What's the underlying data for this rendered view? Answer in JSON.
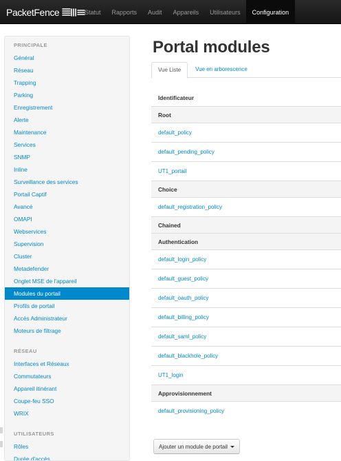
{
  "brand": {
    "name": "PacketFence",
    "logo_icon": "packetfence-logo-icon"
  },
  "navbar": {
    "items": [
      {
        "label": "Statut"
      },
      {
        "label": "Rapports"
      },
      {
        "label": "Audit"
      },
      {
        "label": "Appareils"
      },
      {
        "label": "Utilisateurs"
      },
      {
        "label": "Configuration",
        "active": true
      }
    ]
  },
  "sidebar": {
    "sections": [
      {
        "header": "PRINCIPALE",
        "items": [
          "Général",
          "Réseau",
          "Trapping",
          "Parking",
          "Enregistrement",
          "Alerte",
          "Maintenance",
          "Services",
          "SNMP",
          "Inline",
          "Surveillance des services",
          "Portail Captif",
          "Avancé",
          "OMAPI",
          "Webservices",
          "Supervision",
          "Cluster",
          "Metadefender",
          "Onglet MSE de l'appareil",
          "Modules du portail",
          "Profils de portail",
          "Accès Administrateur",
          "Moteurs de filtrage"
        ]
      },
      {
        "header": "RÉSEAU",
        "items": [
          "Interfaces et Réseaux",
          "Commutateurs",
          "Appareil itinérant",
          "Coupe-feu SSO",
          "WRIX"
        ]
      },
      {
        "header": "UTILISATEURS",
        "items": [
          "Rôles",
          "Durée d'accès"
        ]
      }
    ],
    "active_item": "Modules du portail"
  },
  "main": {
    "title": "Portal modules",
    "tabs": [
      {
        "label": "Vue Liste",
        "active": true
      },
      {
        "label": "Vue en arborescence"
      }
    ],
    "table": {
      "header": "Identificateur",
      "groups": [
        {
          "name": "Root",
          "items": [
            "default_policy",
            "default_pending_policy",
            "UT1_portail"
          ]
        },
        {
          "name": "Choice",
          "items": [
            "default_registration_policy"
          ]
        },
        {
          "name": "Chained",
          "items": []
        },
        {
          "name": "Authentication",
          "items": [
            "default_login_policy",
            "default_guest_policy",
            "default_oauth_policy",
            "default_billing_policy",
            "default_saml_policy",
            "default_blackhole_policy",
            "UT1_login"
          ]
        },
        {
          "name": "Approvisionnement",
          "items": [
            "default_provisioning_policy"
          ]
        }
      ]
    },
    "add_button": {
      "label": "Ajouter un module de portail",
      "icon": "caret-down-icon"
    }
  },
  "colors": {
    "navbar_bg": "#1b1b1b",
    "link": "#0088cc",
    "active_item_bg": "#0088cc",
    "sidebar_bg": "#f5f5f5",
    "group_row_bg": "#f4f4f4"
  }
}
